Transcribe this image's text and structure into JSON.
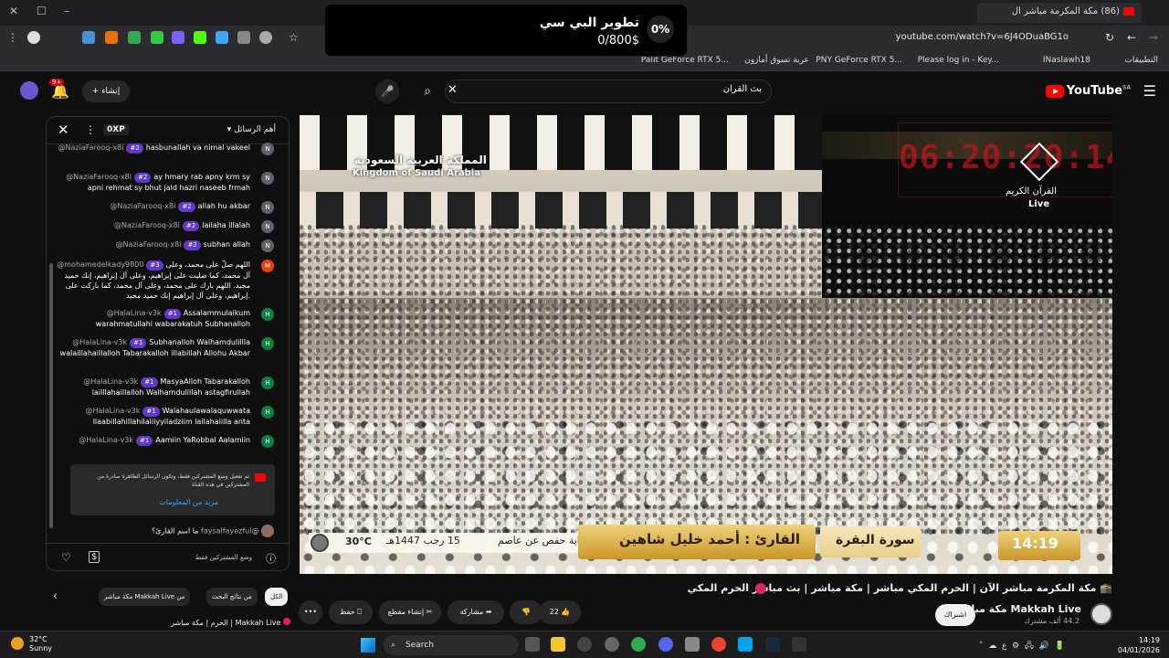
{
  "browser": {
    "tab_title": "(86) مكة المكرمة مباشر ال",
    "url": "youtube.com/watch?v=6J4ODuaBG1o",
    "bookmarks": [
      "التطبيقات",
      "INaslawh18",
      "Please log in - Key...",
      "PNY GeForce RTX 5...",
      "عربة تسوق أمازون",
      "Palit GeForce RTX 5..."
    ]
  },
  "popup": {
    "title": "تطوير البي سي",
    "amount": "0/800$",
    "percent": "0%"
  },
  "header": {
    "logo_text": "YouTube",
    "logo_region": "SA",
    "search_value": "بث القران",
    "create_label": "إنشاء",
    "notif_count": "9+"
  },
  "chat": {
    "title": "أهم الرسائل",
    "xp": "0XP",
    "messages": [
      {
        "author": "@NaziaFarooq-x8i",
        "level": "#2",
        "text": "hasbunallah va nimal vakeel",
        "initial": "N",
        "color": "#5f6368"
      },
      {
        "author": "@NaziaFarooq-x8i",
        "level": "#2",
        "text": "ay hmary rab apny krm sy apni rehmat sy bhut jald hazri naseeb frmah",
        "initial": "N",
        "color": "#5f6368"
      },
      {
        "author": "@NaziaFarooq-x8i",
        "level": "#2",
        "text": "allah hu akbar",
        "initial": "N",
        "color": "#5f6368"
      },
      {
        "author": "@NaziaFarooq-x8i",
        "level": "#2",
        "text": "lailaha illalah",
        "initial": "N",
        "color": "#5f6368"
      },
      {
        "author": "@NaziaFarooq-x8i",
        "level": "#2",
        "text": "subhan allah",
        "initial": "N",
        "color": "#5f6368"
      },
      {
        "author": "@mohamedelkady9800",
        "level": "#3",
        "text": "اللهم صلّ على محمد، وعلى آل محمد، كما صليت على إبراهيم، وعلى آل إبراهيم، إنك حميد مجيد. اللهم بارك على محمد، وعلى آل محمد، كما باركت على إبراهيم، وعلى آل إبراهيم إنك حميد مجيد.",
        "initial": "M",
        "color": "#e8430b"
      },
      {
        "author": "@HalaLina-v3k",
        "level": "#1",
        "text": "Assalammulaikum warahmatullahi wabarakatuh Subhanalloh",
        "initial": "H",
        "color": "#0b8043"
      },
      {
        "author": "@HalaLina-v3k",
        "level": "#1",
        "text": "Subhanalloh Walhamdulillla walaillahaillalloh Tabarakalloh illabillah Allohu Akbar",
        "initial": "H",
        "color": "#0b8043"
      },
      {
        "author": "@HalaLina-v3k",
        "level": "#1",
        "text": "MasyaAlloh Tabarakalloh lailllahaillalloh Walhamdulillah astagfirullah",
        "initial": "H",
        "color": "#0b8043"
      },
      {
        "author": "@HalaLina-v3k",
        "level": "#1",
        "text": "Walahaulawalaquwwata llaabillahillahilaliiyyiladziim lailahaiilla anta",
        "initial": "H",
        "color": "#0b8043"
      },
      {
        "author": "@HalaLina-v3k",
        "level": "#1",
        "text": "Aamiin YaRobbal Aalamiin",
        "initial": "H",
        "color": "#0b8043"
      }
    ],
    "subscriber_notice": "تم تفعيل وضع المشتركين فقط، وتكون الرسائل الظاهرة صادرة من المشتركين في هذه القناة",
    "learn_more": "مزيد من المعلومات",
    "last_author": "@faysalfayezful",
    "last_text": "ما اسم القارئ؟",
    "mode_label": "وضع المشتركين فقط"
  },
  "video": {
    "kingdom_ar": "المملكة العربية السعودية",
    "kingdom_en": "Kingdom of Saudi Arabia",
    "clock": "06:20:20:14",
    "quran_ar": "القرآن الكريم",
    "quran_live": "Live",
    "reader": "القارئ : أحمد خليل شاهين",
    "surah": "سورة البقرة",
    "time": "14:19",
    "rewaya": "رواية حفص عن عاصم",
    "hijri_date": "15 رجب 1447هـ",
    "temp": "30°C"
  },
  "below": {
    "title": "مكة المكرمة مباشر الآن | الحرم المكي مباشر | مكة مباشر | بث مباشر الحرم المكي",
    "channel": "Makkah Live مكة مباشر",
    "subscribers": "44.2 ألف مشترك",
    "subscribe": "اشتراك",
    "likes": "22",
    "share": "مشاركة",
    "clip": "إنشاء مقطع",
    "save": "حفظ",
    "chips": [
      "الكل",
      "من نتائج البحث",
      "من Makkah Live مكة مباشر"
    ],
    "rec_title": "Makkah Live | الحرم | مكة مباشر"
  },
  "taskbar": {
    "temp": "32°C",
    "weather": "Sunny",
    "search": "Search",
    "time": "14:19",
    "date": "04/01/2026"
  }
}
